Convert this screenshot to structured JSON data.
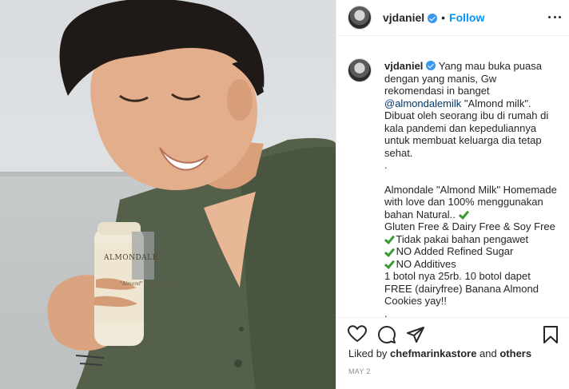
{
  "post": {
    "username": "vjdaniel",
    "dot": "•",
    "follow_label": "Follow",
    "photo": {
      "bottle_brand": "ALMONDALE",
      "bottle_sub": "\"Almond\" Homemade"
    },
    "caption": {
      "username": "vjdaniel",
      "intro_text": " Yang mau buka puasa dengan yang manis, Gw rekomendasi in banget ",
      "mention": "@almondalemilk",
      "intro_rest": " \"Almond milk\". Dibuat oleh seorang ibu di rumah di kala pandemi dan kepeduliannya untuk membuat keluarga dia tetap sehat.",
      "dot_line": ".",
      "para2": "Almondale \"Almond Milk\" Homemade with love dan 100% menggunakan bahan Natural..",
      "check1": "Gluten Free & Dairy Free & Soy Free",
      "check2": "Tidak pakai bahan pengawet",
      "check3": "NO Added Refined Sugar",
      "check4": "NO Additives",
      "price": "1 botol nya 25rb. 10 botol dapet FREE (dairyfree) Banana Almond Cookies yay!!",
      "end_dot": "."
    },
    "likes": {
      "prefix": "Liked by ",
      "user": "chefmarinkastore",
      "middle": " and ",
      "others": "others"
    },
    "date": "MAY 2"
  },
  "icons": {
    "like": "heart-icon",
    "comment": "comment-icon",
    "share": "paper-plane-icon",
    "save": "bookmark-icon",
    "more": "more-horizontal-icon",
    "verified": "verified-badge-icon",
    "check": "check-mark-icon"
  },
  "colors": {
    "follow": "#0095f6",
    "mention": "#00376b",
    "verified": "#3897f0",
    "check": "#3a9a2f",
    "muted": "#8e8e8e"
  }
}
